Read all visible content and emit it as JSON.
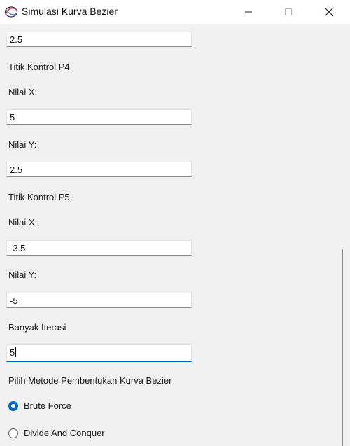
{
  "window": {
    "title": "Simulasi Kurva Bezier",
    "icon": "bezier-curve-icon",
    "controls": [
      "minimize-icon",
      "maximize-icon",
      "close-icon"
    ]
  },
  "form": {
    "p3_y_value": "2.5",
    "p4": {
      "heading": "Titik Kontrol P4",
      "x_label": "Nilai X:",
      "x_value": "5",
      "y_label": "Nilai Y:",
      "y_value": "2.5"
    },
    "p5": {
      "heading": "Titik Kontrol P5",
      "x_label": "Nilai X:",
      "x_value": "-3.5",
      "y_label": "Nilai Y:",
      "y_value": "-5"
    },
    "iterations": {
      "label": "Banyak Iterasi",
      "value": "5"
    },
    "method": {
      "label": "Pilih Metode Pembentukan Kurva Bezier",
      "options": [
        {
          "label": "Brute Force",
          "selected": true
        },
        {
          "label": "Divide And Conquer",
          "selected": false
        }
      ]
    }
  },
  "colors": {
    "accent": "#0067c0",
    "background": "#f0f0f0",
    "titlebar": "#ffffff"
  }
}
